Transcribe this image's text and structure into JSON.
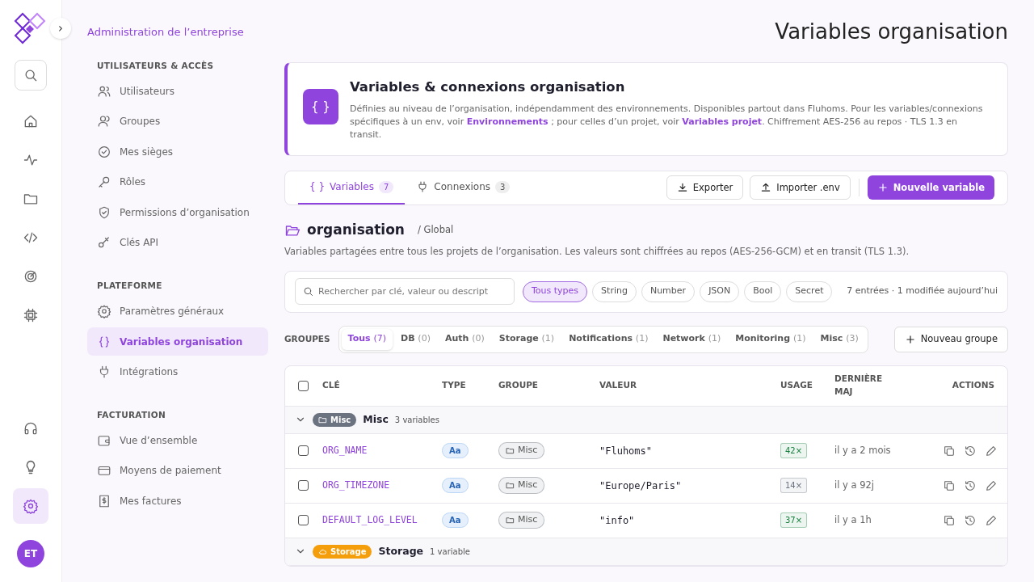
{
  "rail": {
    "expand_label": "›",
    "items": [
      {
        "selected": false
      },
      {
        "selected": false
      },
      {
        "selected": false
      },
      {
        "selected": false
      },
      {
        "selected": false
      },
      {
        "selected": false
      },
      {
        "selected": false
      }
    ],
    "bottom": [
      {
        "selected": false
      },
      {
        "selected": false
      },
      {
        "selected": true
      }
    ],
    "avatar": "ET"
  },
  "sidebar": {
    "title": "Administration de l’entreprise",
    "sections": [
      {
        "heading": "UTILISATEURS & ACCÈS",
        "items": [
          {
            "label": "Utilisateurs",
            "selected": false
          },
          {
            "label": "Groupes",
            "selected": false
          },
          {
            "label": "Mes sièges",
            "selected": false
          },
          {
            "label": "Rôles",
            "selected": false
          },
          {
            "label": "Permissions d’organisation",
            "selected": false
          },
          {
            "label": "Clés API",
            "selected": false
          }
        ]
      },
      {
        "heading": "PLATEFORME",
        "items": [
          {
            "label": "Paramètres généraux",
            "selected": false
          },
          {
            "label": "Variables organisation",
            "selected": true
          },
          {
            "label": "Intégrations",
            "selected": false
          }
        ]
      },
      {
        "heading": "FACTURATION",
        "items": [
          {
            "label": "Vue d’ensemble",
            "selected": false
          },
          {
            "label": "Moyens de paiement",
            "selected": false
          },
          {
            "label": "Mes factures",
            "selected": false
          }
        ]
      }
    ]
  },
  "page_title": "Variables organisation",
  "info": {
    "icon_text": "{ }",
    "title": "Variables & connexions organisation",
    "text": "Définies au niveau de l’organisation, indépendamment des environnements. Disponibles partout dans Fluhoms. Pour les variables/connexions spécifiques à un env, voir ",
    "link1": "Environnements",
    "mid": " ; pour celles d’un projet, voir ",
    "link2": "Variables projet",
    "end": ". Chiffrement AES-256 au repos · TLS 1.3 en transit."
  },
  "tabs": [
    {
      "kind": "text",
      "icon_text": "{ }",
      "label": "Variables",
      "count": "7",
      "selected": true
    },
    {
      "kind": "plug",
      "label": "Connexions",
      "count": "3",
      "selected": false
    }
  ],
  "actions": [
    {
      "kind": "download",
      "label": "Exporter"
    },
    {
      "kind": "upload",
      "label": "Importer .env"
    },
    {
      "kind": "primary",
      "label": "Nouvelle variable"
    }
  ],
  "folder": {
    "name": "organisation",
    "scope": "/ Global",
    "description": "Variables partagées entre tous les projets de l’organisation. Les valeurs sont chiffrées au repos (AES-256-GCM) et en transit (TLS 1.3)."
  },
  "filters": {
    "search": {
      "placeholder": "Rechercher par clé, valeur ou descript"
    },
    "types": [
      {
        "label": "Tous types",
        "selected": true
      },
      {
        "label": "String",
        "selected": false
      },
      {
        "label": "Number",
        "selected": false
      },
      {
        "label": "JSON",
        "selected": false
      },
      {
        "label": "Bool",
        "selected": false
      },
      {
        "label": "Secret",
        "selected": false
      }
    ],
    "summary": "7 entrées · 1 modifiée aujourd’hui"
  },
  "groups": {
    "label": "GROUPES",
    "items": [
      {
        "label": "Tous",
        "count": "(7)",
        "selected": true
      },
      {
        "label": "DB",
        "count": "(0)",
        "selected": false
      },
      {
        "label": "Auth",
        "count": "(0)",
        "selected": false
      },
      {
        "label": "Storage",
        "count": "(1)",
        "selected": false
      },
      {
        "label": "Notifications",
        "count": "(1)",
        "selected": false
      },
      {
        "label": "Network",
        "count": "(1)",
        "selected": false
      },
      {
        "label": "Monitoring",
        "count": "(1)",
        "selected": false
      },
      {
        "label": "Misc",
        "count": "(3)",
        "selected": false
      }
    ],
    "new_button": "Nouveau groupe"
  },
  "table": {
    "columns": [
      "CLÉ",
      "TYPE",
      "GROUPE",
      "VALEUR",
      "USAGE",
      "DERNIÈRE MAJ",
      "ACTIONS"
    ],
    "all_checked": false,
    "sections": [
      {
        "badge": "Misc",
        "color": "#6b7280",
        "name": "Misc",
        "count": "3 variables",
        "expanded": true,
        "rows": [
          {
            "checked": false,
            "key": "ORG_NAME",
            "type": "Aa",
            "group": "Misc",
            "value": "\"Fluhoms\"",
            "usage": "42×",
            "color": "#15803d",
            "updated": "il y a 2 mois"
          },
          {
            "checked": false,
            "key": "ORG_TIMEZONE",
            "type": "Aa",
            "group": "Misc",
            "value": "\"Europe/Paris\"",
            "usage": "14×",
            "color": "#6b7280",
            "updated": "il y a 92j"
          },
          {
            "checked": false,
            "key": "DEFAULT_LOG_LEVEL",
            "type": "Aa",
            "group": "Misc",
            "value": "\"info\"",
            "usage": "37×",
            "color": "#15803d",
            "updated": "il y a 1h"
          }
        ]
      },
      {
        "badge": "Storage",
        "color": "#f59e0b",
        "name": "Storage",
        "count": "1 variable",
        "expanded": true
      }
    ]
  }
}
